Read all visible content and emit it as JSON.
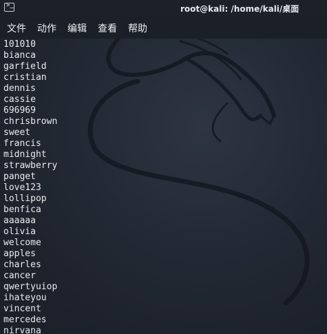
{
  "window": {
    "title": "root@kali: /home/kali/桌面",
    "icon": "terminal-icon",
    "icon_glyph": ">_"
  },
  "menu": {
    "items": [
      "文件",
      "动作",
      "编辑",
      "查看",
      "帮助"
    ]
  },
  "terminal": {
    "lines": [
      "101010",
      "bianca",
      "garfield",
      "cristian",
      "dennis",
      "cassie",
      "696969",
      "chrisbrown",
      "sweet",
      "francis",
      "midnight",
      "strawberry",
      "panget",
      "love123",
      "lollipop",
      "benfica",
      "aaaaaa",
      "olivia",
      "welcome",
      "apples",
      "charles",
      "cancer",
      "qwertyuiop",
      "ihateyou",
      "vincent",
      "mercedes",
      "nirvana"
    ]
  },
  "colors": {
    "background": "#242a35",
    "text": "#e9ebee",
    "titlebar": "#1c2129"
  }
}
